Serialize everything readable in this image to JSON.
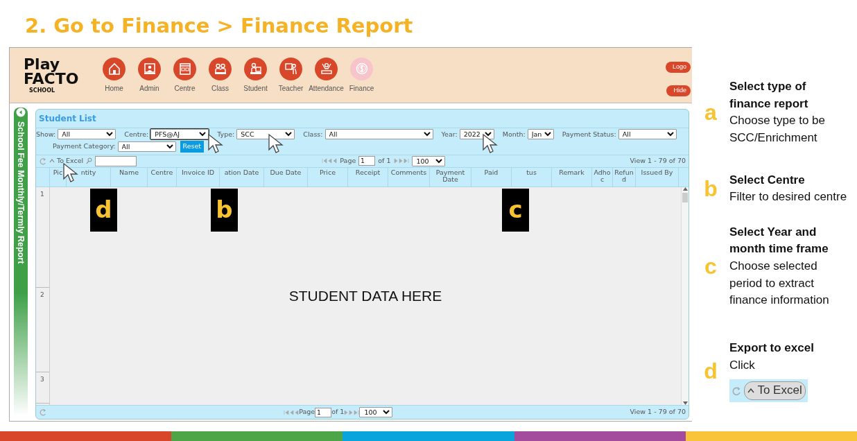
{
  "slide_title": "2. Go to Finance > Finance Report",
  "app": {
    "logo": [
      "Play",
      "FACTO",
      "SCHOOL"
    ],
    "nav": [
      {
        "label": "Home",
        "selected": false
      },
      {
        "label": "Admin",
        "selected": false
      },
      {
        "label": "Centre",
        "selected": false
      },
      {
        "label": "Class",
        "selected": false
      },
      {
        "label": "Student",
        "selected": false
      },
      {
        "label": "Teacher",
        "selected": false
      },
      {
        "label": "Attendance",
        "selected": false
      },
      {
        "label": "Finance",
        "selected": true
      }
    ],
    "header_buttons": [
      "Logo",
      "Hide"
    ],
    "side_tab": "School Fee Monthly/Termly Report",
    "panel_title": "Student List",
    "filters": [
      {
        "label": "Show:",
        "value": "All",
        "focused": false
      },
      {
        "label": "Centre:",
        "value": "PFS@AJ",
        "focused": true,
        "cursor": true,
        "callout": "b"
      },
      {
        "label": "Type:",
        "value": "SCC",
        "focused": false,
        "cursor": true
      },
      {
        "label": "Class:",
        "value": "All",
        "focused": false
      },
      {
        "label": "Year:",
        "value": "2022",
        "focused": false,
        "cursor": true,
        "callout": "c"
      },
      {
        "label": "Month:",
        "value": "Jan",
        "focused": false
      },
      {
        "label": "Payment Status:",
        "value": "All",
        "focused": false
      },
      {
        "label": "Payment Category:",
        "value": "All",
        "focused": false
      }
    ],
    "reset": "Reset",
    "toolbar": {
      "export": "To Excel",
      "cursor": true,
      "callout": "d"
    },
    "pager": {
      "page_label": "Page",
      "page": "1",
      "of": "of 1",
      "per_page": "100",
      "view": "View 1 - 79 of 70"
    },
    "columns": [
      "Pic",
      "ntity",
      "Name",
      "Centre",
      "Invoice ID",
      "ation Date",
      "Due Date",
      "Price",
      "Receipt",
      "Comments",
      "Payment Date",
      "Paid",
      "tus",
      "Remark",
      "Adhoc",
      "Refund",
      "Issued By"
    ],
    "rows": [
      "1",
      "2",
      "3"
    ],
    "body_text": "STUDENT DATA HERE",
    "footer_pager": {
      "page_label": "Page",
      "page": "1",
      "of": "of 1",
      "per_page": "100",
      "view": "View 1 - 79 of 70"
    }
  },
  "steps": [
    {
      "letter": "a",
      "title": "Select type of finance report",
      "text": "Choose type to be SCC/Enrichment"
    },
    {
      "letter": "b",
      "title": "Select Centre",
      "text": "Filter to desired centre"
    },
    {
      "letter": "c",
      "title": "Select Year and month time frame",
      "text": "Choose selected period to extract finance information"
    },
    {
      "letter": "d",
      "title": "Export to excel",
      "text": "Click",
      "button": "To Excel"
    }
  ],
  "stripes": [
    {
      "color": "#d9472b"
    },
    {
      "color": "#4ea548"
    },
    {
      "color": "#0aa4dc"
    },
    {
      "color": "#a34b9c"
    },
    {
      "color": "#f9c43a"
    }
  ]
}
